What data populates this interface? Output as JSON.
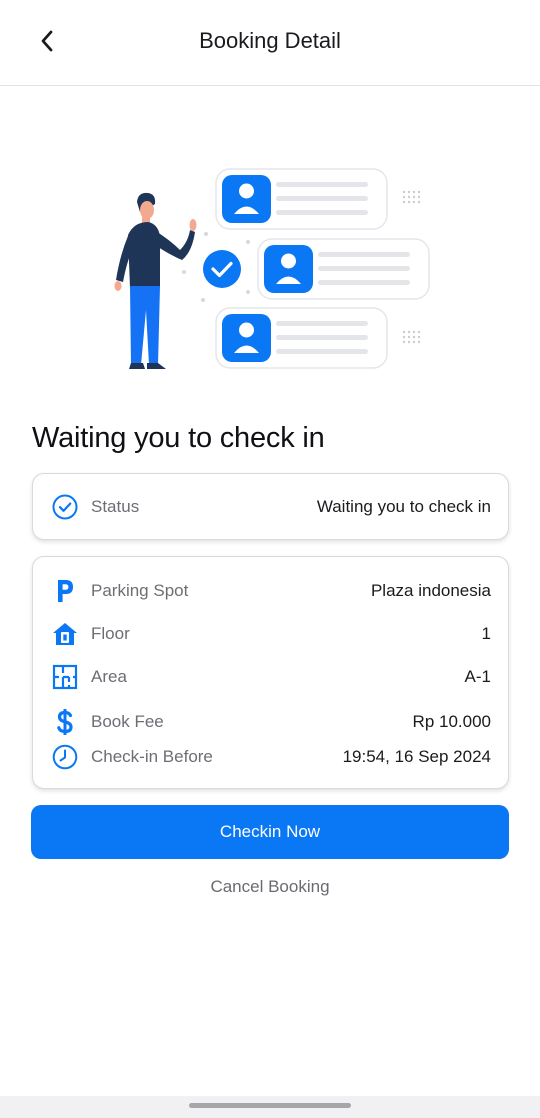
{
  "appbar": {
    "title": "Booking Detail",
    "back_icon": "chevron-left-icon"
  },
  "main": {
    "heading": "Waiting you to check in",
    "status_card": {
      "label": "Status",
      "value": "Waiting you to check in",
      "icon": "check-circle-icon"
    },
    "details": [
      {
        "label": "Parking Spot",
        "value": "Plaza indonesia",
        "icon": "parking-icon"
      },
      {
        "label": "Floor",
        "value": "1",
        "icon": "floor-icon"
      },
      {
        "label": "Area",
        "value": "A-1",
        "icon": "floorplan-icon"
      },
      {
        "label": "Book Fee",
        "value": "Rp 10.000",
        "icon": "dollar-icon"
      },
      {
        "label": "Check-in Before",
        "value": "19:54, 16 Sep 2024",
        "icon": "clock-icon"
      }
    ],
    "primary_button": "Checkin Now",
    "secondary_button": "Cancel Booking"
  },
  "colors": {
    "accent": "#0A78F5",
    "text_primary": "#1B1B1F",
    "text_secondary": "#6D6D74",
    "figure_shirt": "#1E3557",
    "figure_pants": "#1572F5",
    "skin": "#F2A98F"
  },
  "illustration": {
    "name": "person-with-user-list-illustration"
  }
}
